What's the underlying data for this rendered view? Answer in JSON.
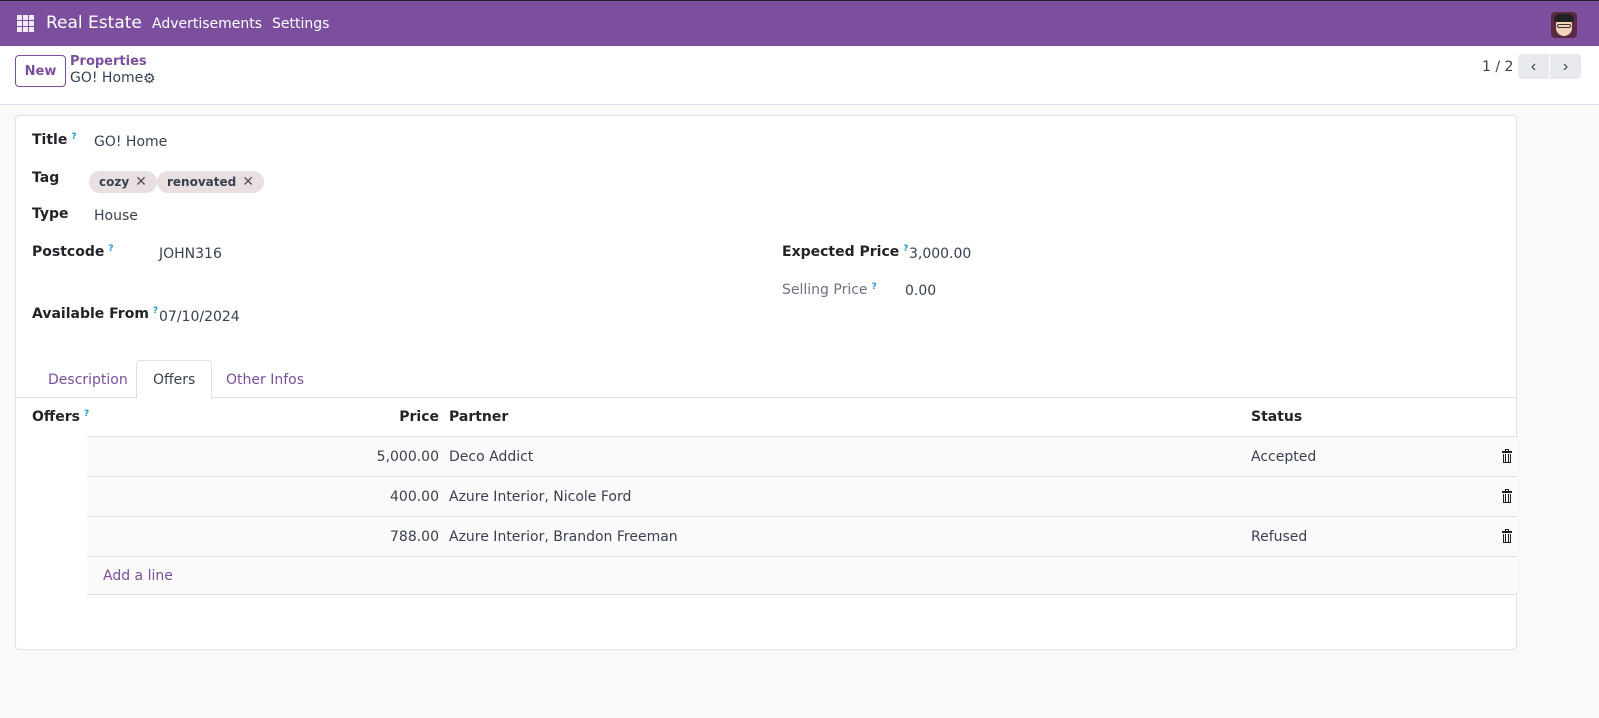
{
  "navbar": {
    "app_name": "Real Estate",
    "menu": [
      "Advertisements",
      "Settings"
    ],
    "icons": {
      "apps": "grid-icon",
      "avatar": "user-avatar"
    }
  },
  "control_panel": {
    "new_label": "New",
    "breadcrumb_parent": "Properties",
    "breadcrumb_current": "GO! Home",
    "pager": "1 / 2",
    "prev_icon": "‹",
    "next_icon": "›",
    "gear_icon": "⚙"
  },
  "form": {
    "title_label": "Title",
    "title_value": "GO! Home",
    "tag_label": "Tag",
    "tags": [
      "cozy",
      "renovated"
    ],
    "tag_remove": "✕",
    "type_label": "Type",
    "type_value": "House",
    "postcode_label": "Postcode",
    "postcode_value": "JOHN316",
    "available_label": "Available From",
    "available_value": "07/10/2024",
    "expected_price_label": "Expected Price",
    "expected_price_value": "3,000.00",
    "selling_price_label": "Selling Price",
    "selling_price_value": "0.00",
    "help_mark": "?"
  },
  "tabs": [
    {
      "label": "Description",
      "active": false
    },
    {
      "label": "Offers",
      "active": true
    },
    {
      "label": "Other Infos",
      "active": false
    }
  ],
  "offers": {
    "label": "Offers",
    "columns": [
      "Price",
      "Partner",
      "Status"
    ],
    "rows": [
      {
        "price": "5,000.00",
        "partner": "Deco Addict",
        "status": "Accepted"
      },
      {
        "price": "400.00",
        "partner": "Azure Interior, Nicole Ford",
        "status": ""
      },
      {
        "price": "788.00",
        "partner": "Azure Interior, Brandon Freeman",
        "status": "Refused"
      }
    ],
    "add_line": "Add a line"
  },
  "colors": {
    "brand": "#7b4f9e",
    "help": "#1f9bd1",
    "tag_bg": "#e9dfe0"
  }
}
